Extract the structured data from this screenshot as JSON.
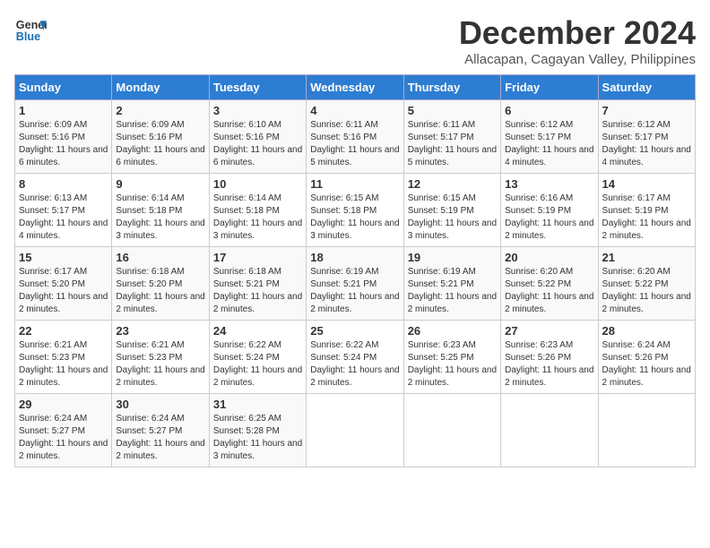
{
  "header": {
    "logo_line1": "General",
    "logo_line2": "Blue",
    "month": "December 2024",
    "location": "Allacapan, Cagayan Valley, Philippines"
  },
  "weekdays": [
    "Sunday",
    "Monday",
    "Tuesday",
    "Wednesday",
    "Thursday",
    "Friday",
    "Saturday"
  ],
  "weeks": [
    [
      {
        "day": 1,
        "sunrise": "6:09 AM",
        "sunset": "5:16 PM",
        "daylight": "11 hours and 6 minutes."
      },
      {
        "day": 2,
        "sunrise": "6:09 AM",
        "sunset": "5:16 PM",
        "daylight": "11 hours and 6 minutes."
      },
      {
        "day": 3,
        "sunrise": "6:10 AM",
        "sunset": "5:16 PM",
        "daylight": "11 hours and 6 minutes."
      },
      {
        "day": 4,
        "sunrise": "6:11 AM",
        "sunset": "5:16 PM",
        "daylight": "11 hours and 5 minutes."
      },
      {
        "day": 5,
        "sunrise": "6:11 AM",
        "sunset": "5:17 PM",
        "daylight": "11 hours and 5 minutes."
      },
      {
        "day": 6,
        "sunrise": "6:12 AM",
        "sunset": "5:17 PM",
        "daylight": "11 hours and 4 minutes."
      },
      {
        "day": 7,
        "sunrise": "6:12 AM",
        "sunset": "5:17 PM",
        "daylight": "11 hours and 4 minutes."
      }
    ],
    [
      {
        "day": 8,
        "sunrise": "6:13 AM",
        "sunset": "5:17 PM",
        "daylight": "11 hours and 4 minutes."
      },
      {
        "day": 9,
        "sunrise": "6:14 AM",
        "sunset": "5:18 PM",
        "daylight": "11 hours and 3 minutes."
      },
      {
        "day": 10,
        "sunrise": "6:14 AM",
        "sunset": "5:18 PM",
        "daylight": "11 hours and 3 minutes."
      },
      {
        "day": 11,
        "sunrise": "6:15 AM",
        "sunset": "5:18 PM",
        "daylight": "11 hours and 3 minutes."
      },
      {
        "day": 12,
        "sunrise": "6:15 AM",
        "sunset": "5:19 PM",
        "daylight": "11 hours and 3 minutes."
      },
      {
        "day": 13,
        "sunrise": "6:16 AM",
        "sunset": "5:19 PM",
        "daylight": "11 hours and 2 minutes."
      },
      {
        "day": 14,
        "sunrise": "6:17 AM",
        "sunset": "5:19 PM",
        "daylight": "11 hours and 2 minutes."
      }
    ],
    [
      {
        "day": 15,
        "sunrise": "6:17 AM",
        "sunset": "5:20 PM",
        "daylight": "11 hours and 2 minutes."
      },
      {
        "day": 16,
        "sunrise": "6:18 AM",
        "sunset": "5:20 PM",
        "daylight": "11 hours and 2 minutes."
      },
      {
        "day": 17,
        "sunrise": "6:18 AM",
        "sunset": "5:21 PM",
        "daylight": "11 hours and 2 minutes."
      },
      {
        "day": 18,
        "sunrise": "6:19 AM",
        "sunset": "5:21 PM",
        "daylight": "11 hours and 2 minutes."
      },
      {
        "day": 19,
        "sunrise": "6:19 AM",
        "sunset": "5:21 PM",
        "daylight": "11 hours and 2 minutes."
      },
      {
        "day": 20,
        "sunrise": "6:20 AM",
        "sunset": "5:22 PM",
        "daylight": "11 hours and 2 minutes."
      },
      {
        "day": 21,
        "sunrise": "6:20 AM",
        "sunset": "5:22 PM",
        "daylight": "11 hours and 2 minutes."
      }
    ],
    [
      {
        "day": 22,
        "sunrise": "6:21 AM",
        "sunset": "5:23 PM",
        "daylight": "11 hours and 2 minutes."
      },
      {
        "day": 23,
        "sunrise": "6:21 AM",
        "sunset": "5:23 PM",
        "daylight": "11 hours and 2 minutes."
      },
      {
        "day": 24,
        "sunrise": "6:22 AM",
        "sunset": "5:24 PM",
        "daylight": "11 hours and 2 minutes."
      },
      {
        "day": 25,
        "sunrise": "6:22 AM",
        "sunset": "5:24 PM",
        "daylight": "11 hours and 2 minutes."
      },
      {
        "day": 26,
        "sunrise": "6:23 AM",
        "sunset": "5:25 PM",
        "daylight": "11 hours and 2 minutes."
      },
      {
        "day": 27,
        "sunrise": "6:23 AM",
        "sunset": "5:26 PM",
        "daylight": "11 hours and 2 minutes."
      },
      {
        "day": 28,
        "sunrise": "6:24 AM",
        "sunset": "5:26 PM",
        "daylight": "11 hours and 2 minutes."
      }
    ],
    [
      {
        "day": 29,
        "sunrise": "6:24 AM",
        "sunset": "5:27 PM",
        "daylight": "11 hours and 2 minutes."
      },
      {
        "day": 30,
        "sunrise": "6:24 AM",
        "sunset": "5:27 PM",
        "daylight": "11 hours and 2 minutes."
      },
      {
        "day": 31,
        "sunrise": "6:25 AM",
        "sunset": "5:28 PM",
        "daylight": "11 hours and 3 minutes."
      },
      null,
      null,
      null,
      null
    ]
  ]
}
